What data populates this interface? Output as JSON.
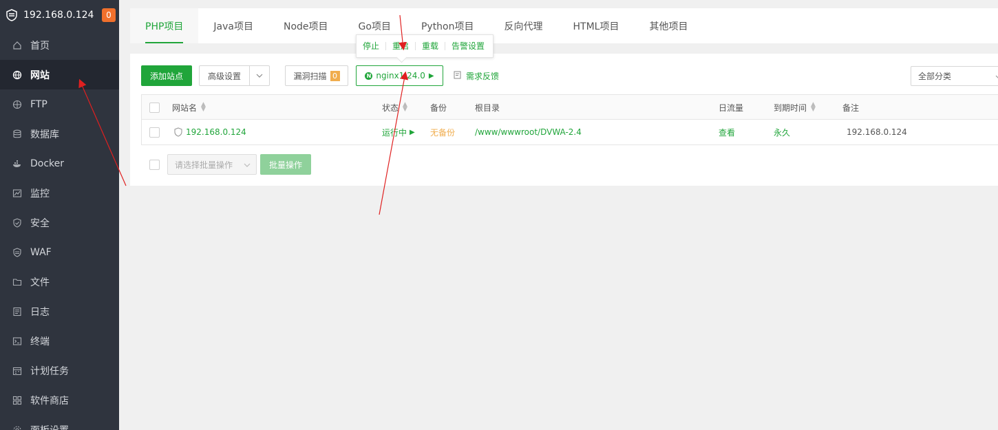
{
  "sidebar": {
    "host": "192.168.0.124",
    "badge": "0",
    "items": [
      {
        "label": "首页",
        "icon": "home-icon"
      },
      {
        "label": "网站",
        "icon": "globe-icon"
      },
      {
        "label": "FTP",
        "icon": "ftp-icon"
      },
      {
        "label": "数据库",
        "icon": "database-icon"
      },
      {
        "label": "Docker",
        "icon": "docker-icon"
      },
      {
        "label": "监控",
        "icon": "monitor-icon"
      },
      {
        "label": "安全",
        "icon": "shield-icon"
      },
      {
        "label": "WAF",
        "icon": "waf-icon"
      },
      {
        "label": "文件",
        "icon": "folder-icon"
      },
      {
        "label": "日志",
        "icon": "log-icon"
      },
      {
        "label": "终端",
        "icon": "terminal-icon"
      },
      {
        "label": "计划任务",
        "icon": "calendar-icon"
      },
      {
        "label": "软件商店",
        "icon": "apps-icon"
      },
      {
        "label": "面板设置",
        "icon": "settings-icon"
      }
    ]
  },
  "tabs": [
    "PHP项目",
    "Java项目",
    "Node项目",
    "Go项目",
    "Python项目",
    "反向代理",
    "HTML项目",
    "其他项目"
  ],
  "toolbar": {
    "add_site": "添加站点",
    "advanced": "高级设置",
    "scan": "漏洞扫描",
    "scan_count": "0",
    "nginx": "nginx1.24.0",
    "feedback": "需求反馈",
    "category": "全部分类"
  },
  "popover": [
    "停止",
    "重启",
    "重载",
    "告警设置"
  ],
  "table": {
    "headers": {
      "name": "网站名",
      "status": "状态",
      "backup": "备份",
      "root": "根目录",
      "traffic": "日流量",
      "expire": "到期时间",
      "note": "备注"
    },
    "rows": [
      {
        "name": "192.168.0.124",
        "status": "运行中",
        "backup": "无备份",
        "root": "/www/wwwroot/DVWA-2.4",
        "traffic": "查看",
        "expire": "永久",
        "note": "192.168.0.124"
      }
    ]
  },
  "batch": {
    "placeholder": "请选择批量操作",
    "button": "批量操作"
  },
  "colors": {
    "accent": "#20a53a",
    "sidebar_bg": "#2f343e",
    "warning": "#f0ad4e",
    "annotation": "#e02020"
  }
}
